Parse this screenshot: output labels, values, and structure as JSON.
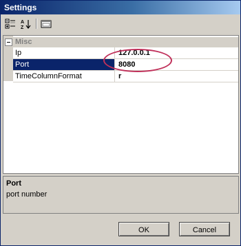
{
  "window": {
    "title": "Settings"
  },
  "toolbar": {
    "icons": [
      "categorized-icon",
      "alphabetical-icon",
      "property-pages-icon"
    ],
    "alphabetical_glyph": "A↓Z"
  },
  "grid": {
    "category": "Misc",
    "properties": [
      {
        "name": "Ip",
        "value": "127.0.0.1",
        "selected": false
      },
      {
        "name": "Port",
        "value": "8080",
        "selected": true
      },
      {
        "name": "TimeColumnFormat",
        "value": "r",
        "selected": false
      }
    ]
  },
  "help": {
    "title": "Port",
    "description": "port number"
  },
  "buttons": {
    "ok": "OK",
    "cancel": "Cancel"
  },
  "colors": {
    "selection": "#0a246a",
    "annotation": "#c0305a",
    "titlebar": "#0a246a"
  }
}
